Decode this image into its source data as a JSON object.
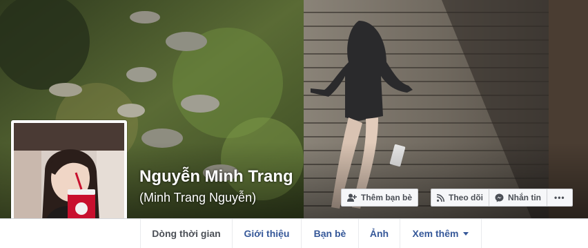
{
  "profile": {
    "name": "Nguyễn Minh Trang",
    "alternate_name": "(Minh Trang Nguyễn)"
  },
  "actions": {
    "add_friend": "Thêm bạn bè",
    "follow": "Theo dõi",
    "message": "Nhắn tin",
    "more": "•••"
  },
  "tabs": [
    {
      "label": "Dòng thời gian",
      "active": true
    },
    {
      "label": "Giới thiệu",
      "active": false
    },
    {
      "label": "Bạn bè",
      "active": false
    },
    {
      "label": "Ảnh",
      "active": false
    },
    {
      "label": "Xem thêm",
      "active": false
    }
  ],
  "icons": {
    "add_friend": "add-friend-icon",
    "follow": "rss-follow-icon",
    "message": "messenger-icon",
    "more_tab": "caret-down-icon"
  },
  "colors": {
    "link_blue": "#365899",
    "button_bg": "#f6f7f9",
    "button_border": "#ced0d4",
    "page_bg": "#e9ebee"
  }
}
